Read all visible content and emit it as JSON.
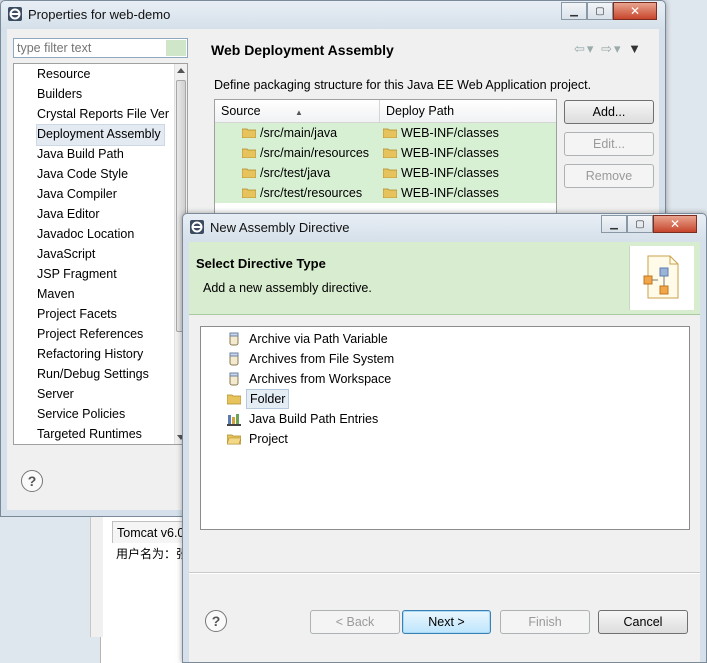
{
  "props_window": {
    "title": "Properties for web-demo",
    "filter_placeholder": "type filter text",
    "nav_items": [
      "Resource",
      "Builders",
      "Crystal Reports File Ver",
      "Deployment Assembly",
      "Java Build Path",
      "Java Code Style",
      "Java Compiler",
      "Java Editor",
      "Javadoc Location",
      "JavaScript",
      "JSP Fragment",
      "Maven",
      "Project Facets",
      "Project References",
      "Refactoring History",
      "Run/Debug Settings",
      "Server",
      "Service Policies",
      "Targeted Runtimes"
    ],
    "selected_nav": "Deployment Assembly",
    "page_title": "Web Deployment Assembly",
    "page_description": "Define packaging structure for this Java EE Web Application project.",
    "table": {
      "columns": [
        "Source",
        "Deploy Path"
      ],
      "rows": [
        {
          "source": "/src/main/java",
          "deploy": "WEB-INF/classes"
        },
        {
          "source": "/src/main/resources",
          "deploy": "WEB-INF/classes"
        },
        {
          "source": "/src/test/java",
          "deploy": "WEB-INF/classes"
        },
        {
          "source": "/src/test/resources",
          "deploy": "WEB-INF/classes"
        }
      ]
    },
    "buttons": {
      "add": "Add...",
      "edit": "Edit...",
      "remove": "Remove"
    },
    "help": "?"
  },
  "background": {
    "console_tab": "Tomcat v6.0",
    "console_text": "用户名为：张"
  },
  "dialog": {
    "title": "New Assembly Directive",
    "heading": "Select Directive Type",
    "description": "Add a new assembly directive.",
    "options": [
      {
        "label": "Archive via Path Variable",
        "icon": "jar-icon"
      },
      {
        "label": "Archives from File System",
        "icon": "jar-icon"
      },
      {
        "label": "Archives from Workspace",
        "icon": "jar-icon"
      },
      {
        "label": "Folder",
        "icon": "folder-icon"
      },
      {
        "label": "Java Build Path Entries",
        "icon": "library-icon"
      },
      {
        "label": "Project",
        "icon": "project-icon"
      }
    ],
    "selected_option": "Folder",
    "buttons": {
      "back": "< Back",
      "next": "Next >",
      "finish": "Finish",
      "cancel": "Cancel"
    },
    "help": "?"
  },
  "colors": {
    "selection_green": "#d7f0d3",
    "banner_green": "#d8eccf",
    "accent_blue": "#3c7fb1"
  }
}
